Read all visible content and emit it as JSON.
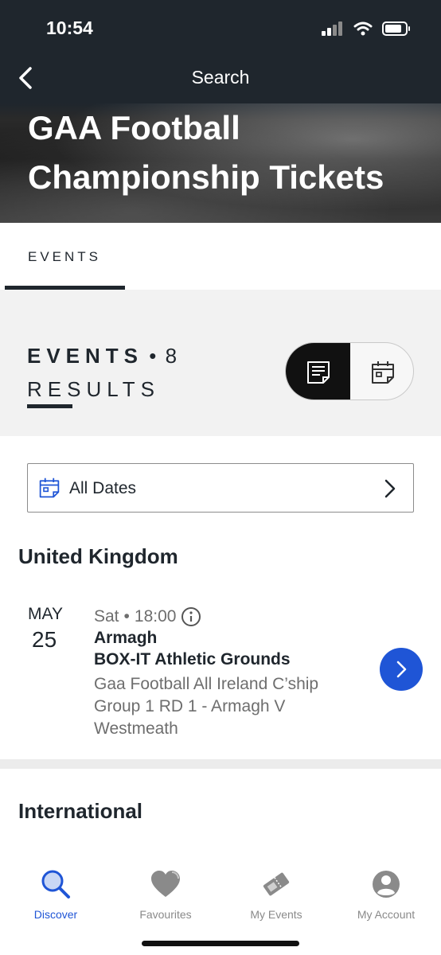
{
  "status": {
    "time": "10:54"
  },
  "nav": {
    "title": "Search"
  },
  "hero": {
    "title": "GAA Football Championship Tickets"
  },
  "tabs": [
    {
      "label": "EVENTS",
      "active": true
    }
  ],
  "results": {
    "label": "EVENTS",
    "count": "8",
    "suffix": "RESULTS",
    "view": "list"
  },
  "filter": {
    "label": "All Dates"
  },
  "regions": [
    {
      "name": "United Kingdom",
      "events": [
        {
          "month": "MAY",
          "day": "25",
          "weekday": "Sat",
          "time": "18:00",
          "city": "Armagh",
          "venue": "BOX-IT Athletic Grounds",
          "description": "Gaa Football All Ireland C’ship Group 1 RD 1 - Armagh V Westmeath"
        }
      ]
    },
    {
      "name": "International",
      "events": []
    }
  ],
  "tabbar": [
    {
      "label": "Discover",
      "icon": "search-icon",
      "active": true
    },
    {
      "label": "Favourites",
      "icon": "heart-icon"
    },
    {
      "label": "My Events",
      "icon": "ticket-icon"
    },
    {
      "label": "My Account",
      "icon": "account-icon"
    }
  ],
  "colors": {
    "accent": "#1f55d6",
    "dark": "#1f262d",
    "muted": "#6e6e6e"
  }
}
